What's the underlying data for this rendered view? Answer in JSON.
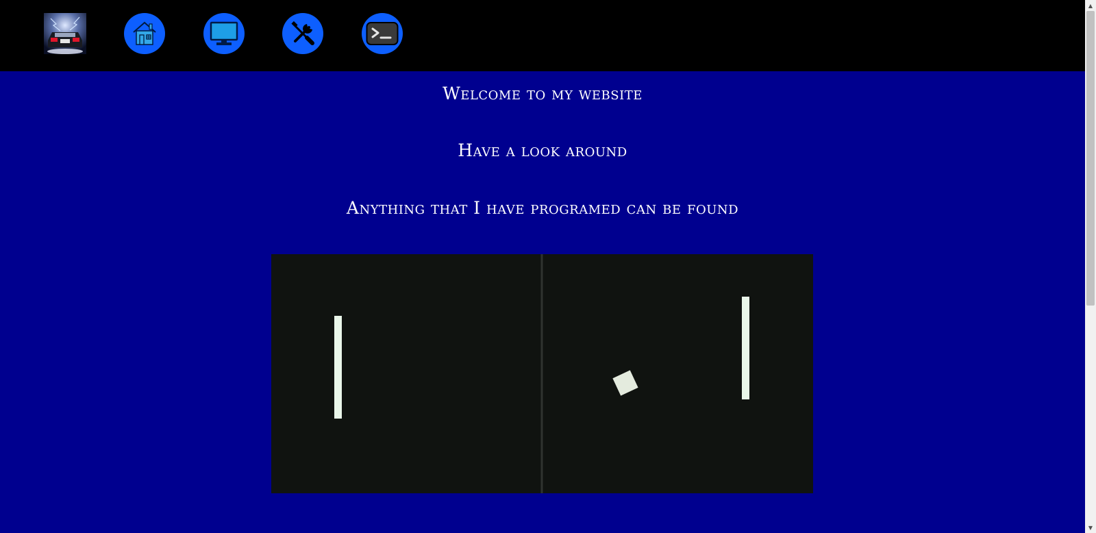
{
  "nav": {
    "logo_alt": "car logo",
    "items": [
      {
        "name": "home",
        "icon": "house-icon"
      },
      {
        "name": "computer",
        "icon": "monitor-icon"
      },
      {
        "name": "tools",
        "icon": "wrench-screwdriver-icon"
      },
      {
        "name": "terminal",
        "icon": "terminal-icon"
      }
    ]
  },
  "main": {
    "line1": "Welcome to my website",
    "line2": "Have a look around",
    "line3": "Anything that I have programed can be found"
  },
  "game": {
    "type": "pong-animation"
  },
  "colors": {
    "page_bg": "#00008f",
    "nav_bg": "#000000",
    "nav_button": "#0d5fff",
    "game_bg": "#101310",
    "paddle": "#eaf7ea"
  }
}
